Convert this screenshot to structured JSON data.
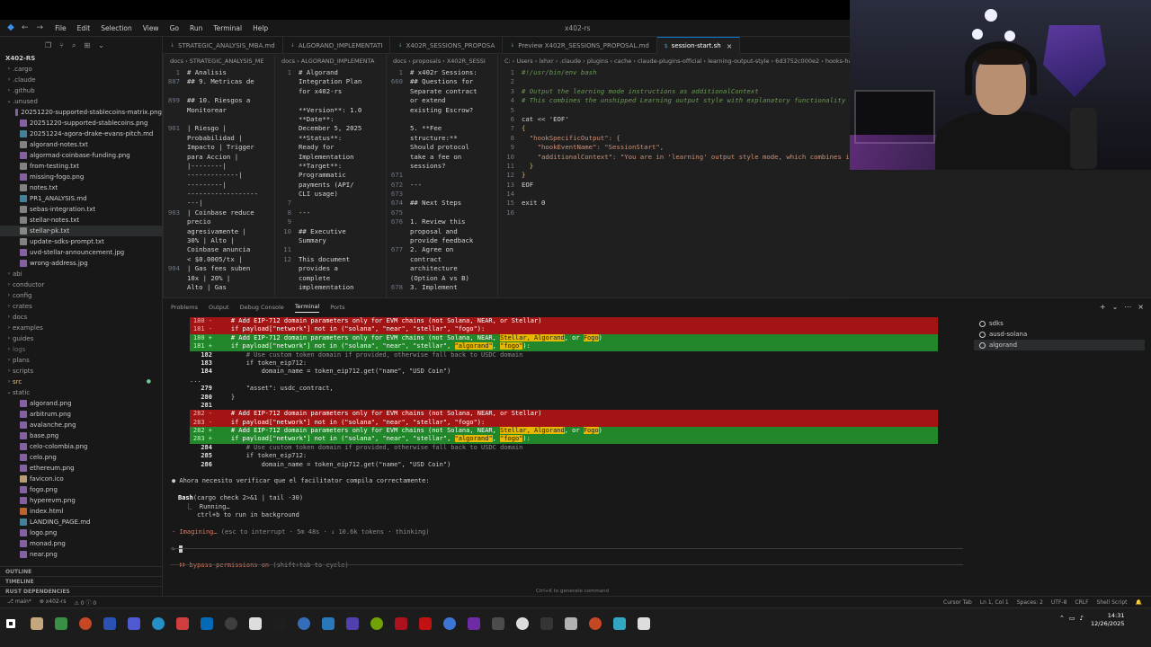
{
  "window": {
    "title": "x402-rs",
    "menu": [
      "File",
      "Edit",
      "Selection",
      "View",
      "Go",
      "Run",
      "Terminal",
      "Help"
    ]
  },
  "explorer": {
    "root": "X402-RS",
    "items": [
      {
        "label": ".cargo",
        "kind": "folder",
        "indent": 0,
        "color": "#9d9d9d"
      },
      {
        "label": ".claude",
        "kind": "folder",
        "indent": 0,
        "color": "#9d9d9d"
      },
      {
        "label": ".github",
        "kind": "folder",
        "indent": 0,
        "color": "#9d9d9d"
      },
      {
        "label": ".unused",
        "kind": "folder-open",
        "indent": 0,
        "color": "#9d9d9d"
      },
      {
        "label": "20251220-supported-stablecoins-matrix.png",
        "kind": "file",
        "indent": 1,
        "color": "#a074c4"
      },
      {
        "label": "20251220-supported-stablecoins.png",
        "kind": "file",
        "indent": 1,
        "color": "#a074c4"
      },
      {
        "label": "20251224-agora-drake-evans-pitch.md",
        "kind": "file",
        "indent": 1,
        "color": "#519aba"
      },
      {
        "label": "algorand-notes.txt",
        "kind": "file",
        "indent": 1,
        "color": "#9d9d9d"
      },
      {
        "label": "algormad-coinbase-funding.png",
        "kind": "file",
        "indent": 1,
        "color": "#a074c4"
      },
      {
        "label": "from-testing.txt",
        "kind": "file",
        "indent": 1,
        "color": "#9d9d9d"
      },
      {
        "label": "missing-fogo.png",
        "kind": "file",
        "indent": 1,
        "color": "#a074c4"
      },
      {
        "label": "notes.txt",
        "kind": "file",
        "indent": 1,
        "color": "#9d9d9d"
      },
      {
        "label": "PR1_ANALYSIS.md",
        "kind": "file",
        "indent": 1,
        "color": "#519aba"
      },
      {
        "label": "sebas-integration.txt",
        "kind": "file",
        "indent": 1,
        "color": "#9d9d9d"
      },
      {
        "label": "stellar-notes.txt",
        "kind": "file",
        "indent": 1,
        "color": "#9d9d9d"
      },
      {
        "label": "stellar-pk.txt",
        "kind": "file",
        "indent": 1,
        "color": "#9d9d9d",
        "selected": true
      },
      {
        "label": "update-sdks-prompt.txt",
        "kind": "file",
        "indent": 1,
        "color": "#9d9d9d"
      },
      {
        "label": "uvd-stellar-announcement.jpg",
        "kind": "file",
        "indent": 1,
        "color": "#a074c4"
      },
      {
        "label": "wrong-address.jpg",
        "kind": "file",
        "indent": 1,
        "color": "#a074c4"
      },
      {
        "label": "abi",
        "kind": "folder",
        "indent": 0,
        "color": "#9d9d9d"
      },
      {
        "label": "conductor",
        "kind": "folder",
        "indent": 0,
        "color": "#9d9d9d"
      },
      {
        "label": "config",
        "kind": "folder",
        "indent": 0,
        "color": "#9d9d9d"
      },
      {
        "label": "crates",
        "kind": "folder",
        "indent": 0,
        "color": "#9d9d9d"
      },
      {
        "label": "docs",
        "kind": "folder",
        "indent": 0,
        "color": "#9d9d9d"
      },
      {
        "label": "examples",
        "kind": "folder",
        "indent": 0,
        "color": "#9d9d9d"
      },
      {
        "label": "guides",
        "kind": "folder",
        "indent": 0,
        "color": "#9d9d9d"
      },
      {
        "label": "logs",
        "kind": "folder",
        "indent": 0,
        "color": "#6e6e6e"
      },
      {
        "label": "plans",
        "kind": "folder",
        "indent": 0,
        "color": "#9d9d9d"
      },
      {
        "label": "scripts",
        "kind": "folder",
        "indent": 0,
        "color": "#9d9d9d"
      },
      {
        "label": "src",
        "kind": "folder",
        "indent": 0,
        "color": "#e2c08d",
        "dot": true
      },
      {
        "label": "static",
        "kind": "folder-open",
        "indent": 0,
        "color": "#9d9d9d"
      },
      {
        "label": "algorand.png",
        "kind": "file",
        "indent": 1,
        "color": "#a074c4"
      },
      {
        "label": "arbitrum.png",
        "kind": "file",
        "indent": 1,
        "color": "#a074c4"
      },
      {
        "label": "avalanche.png",
        "kind": "file",
        "indent": 1,
        "color": "#a074c4"
      },
      {
        "label": "base.png",
        "kind": "file",
        "indent": 1,
        "color": "#a074c4"
      },
      {
        "label": "celo-colombia.png",
        "kind": "file",
        "indent": 1,
        "color": "#a074c4"
      },
      {
        "label": "celo.png",
        "kind": "file",
        "indent": 1,
        "color": "#a074c4"
      },
      {
        "label": "ethereum.png",
        "kind": "file",
        "indent": 1,
        "color": "#a074c4"
      },
      {
        "label": "favicon.ico",
        "kind": "file",
        "indent": 1,
        "color": "#e2c08d"
      },
      {
        "label": "fogo.png",
        "kind": "file",
        "indent": 1,
        "color": "#a074c4"
      },
      {
        "label": "hyperevm.png",
        "kind": "file",
        "indent": 1,
        "color": "#a074c4"
      },
      {
        "label": "index.html",
        "kind": "file",
        "indent": 1,
        "color": "#e37933"
      },
      {
        "label": "LANDING_PAGE.md",
        "kind": "file",
        "indent": 1,
        "color": "#519aba"
      },
      {
        "label": "logo.png",
        "kind": "file",
        "indent": 1,
        "color": "#a074c4"
      },
      {
        "label": "monad.png",
        "kind": "file",
        "indent": 1,
        "color": "#a074c4"
      },
      {
        "label": "near.png",
        "kind": "file",
        "indent": 1,
        "color": "#a074c4"
      }
    ],
    "outline": "OUTLINE",
    "timeline": "TIMELINE",
    "rust_deps": "RUST DEPENDENCIES"
  },
  "tabs": [
    {
      "label": "STRATEGIC_ANALYSIS_MBA.md",
      "active": false
    },
    {
      "label": "ALGORAND_IMPLEMENTATI",
      "active": false
    },
    {
      "label": "X402R_SESSIONS_PROPOSA",
      "active": false
    },
    {
      "label": "Preview X402R_SESSIONS_PROPOSAL.md",
      "active": false
    },
    {
      "label": "session-start.sh",
      "active": true
    }
  ],
  "panes": [
    {
      "crumb": "docs › STRATEGIC_ANALYSIS_ME",
      "lines": [
        {
          "n": "1",
          "t": "# Analisis"
        },
        {
          "n": "887",
          "t": "## 9. Metricas de"
        },
        {
          "n": "",
          "t": ""
        },
        {
          "n": "899",
          "t": "## 10. Riesgos a"
        },
        {
          "n": "",
          "t": "Monitorear"
        },
        {
          "n": "",
          "t": ""
        },
        {
          "n": "901",
          "t": "| Riesgo |"
        },
        {
          "n": "",
          "t": "Probabilidad |"
        },
        {
          "n": "",
          "t": "Impacto | Trigger"
        },
        {
          "n": "",
          "t": "para Accion |"
        },
        {
          "n": "",
          "t": "|--------|"
        },
        {
          "n": "",
          "t": "-------------|"
        },
        {
          "n": "",
          "t": "---------|"
        },
        {
          "n": "",
          "t": "------------------"
        },
        {
          "n": "",
          "t": "---|"
        },
        {
          "n": "903",
          "t": "| Coinbase reduce"
        },
        {
          "n": "",
          "t": "precio"
        },
        {
          "n": "",
          "t": "agresivamente |"
        },
        {
          "n": "",
          "t": "30% | Alto |"
        },
        {
          "n": "",
          "t": "Coinbase anuncia"
        },
        {
          "n": "",
          "t": "< $0.0005/tx |"
        },
        {
          "n": "904",
          "t": "| Gas fees suben"
        },
        {
          "n": "",
          "t": "10x | 20% |"
        },
        {
          "n": "",
          "t": "Alto | Gas"
        }
      ]
    },
    {
      "crumb": "docs › ALGORAND_IMPLEMENTA",
      "lines": [
        {
          "n": "1",
          "t": "# Algorand"
        },
        {
          "n": "",
          "t": "Integration Plan"
        },
        {
          "n": "",
          "t": "for x402-rs"
        },
        {
          "n": "",
          "t": ""
        },
        {
          "n": "",
          "t": "**Version**: 1.0"
        },
        {
          "n": "",
          "t": "**Date**:"
        },
        {
          "n": "",
          "t": "December 5, 2025"
        },
        {
          "n": "",
          "t": "**Status**:"
        },
        {
          "n": "",
          "t": "Ready for"
        },
        {
          "n": "",
          "t": "Implementation"
        },
        {
          "n": "",
          "t": "**Target**:"
        },
        {
          "n": "",
          "t": "Programmatic"
        },
        {
          "n": "",
          "t": "payments (API/"
        },
        {
          "n": "",
          "t": "CLI usage)"
        },
        {
          "n": "7",
          "t": ""
        },
        {
          "n": "8",
          "t": "---"
        },
        {
          "n": "9",
          "t": ""
        },
        {
          "n": "10",
          "t": "## Executive"
        },
        {
          "n": "",
          "t": "Summary"
        },
        {
          "n": "11",
          "t": ""
        },
        {
          "n": "12",
          "t": "This document"
        },
        {
          "n": "",
          "t": "provides a"
        },
        {
          "n": "",
          "t": "complete"
        },
        {
          "n": "",
          "t": "implementation"
        }
      ]
    },
    {
      "crumb": "docs › proposals › X402R_SESSI",
      "lines": [
        {
          "n": "1",
          "t": "# x402r Sessions:"
        },
        {
          "n": "660",
          "t": "## Questions for"
        },
        {
          "n": "",
          "t": "Separate contract"
        },
        {
          "n": "",
          "t": "or extend"
        },
        {
          "n": "",
          "t": "existing Escrow?"
        },
        {
          "n": "",
          "t": ""
        },
        {
          "n": "",
          "t": "5. **Fee"
        },
        {
          "n": "",
          "t": "structure:**"
        },
        {
          "n": "",
          "t": "Should protocol"
        },
        {
          "n": "",
          "t": "take a fee on"
        },
        {
          "n": "",
          "t": "sessions?"
        },
        {
          "n": "671",
          "t": ""
        },
        {
          "n": "672",
          "t": "---"
        },
        {
          "n": "673",
          "t": ""
        },
        {
          "n": "674",
          "t": "## Next Steps"
        },
        {
          "n": "675",
          "t": ""
        },
        {
          "n": "676",
          "t": "1. Review this"
        },
        {
          "n": "",
          "t": "proposal and"
        },
        {
          "n": "",
          "t": "provide feedback"
        },
        {
          "n": "677",
          "t": "2. Agree on"
        },
        {
          "n": "",
          "t": "contract"
        },
        {
          "n": "",
          "t": "architecture"
        },
        {
          "n": "",
          "t": "(Option A vs B)"
        },
        {
          "n": "678",
          "t": "3. Implement"
        }
      ]
    },
    {
      "crumb": "C: › Users › lxhxr › .claude › plugins › cache › claude-plugins-official › learning-output-style › 6d3752c000e2 › hooks-handlers › session-start.sh",
      "lines": [
        {
          "n": "1",
          "t": "#!/usr/bin/env bash",
          "cls": "c-green"
        },
        {
          "n": "2",
          "t": ""
        },
        {
          "n": "3",
          "t": "# Output the learning mode instructions as additionalContext",
          "cls": "c-green"
        },
        {
          "n": "4",
          "t": "# This combines the unshipped Learning output style with explanatory functionality",
          "cls": "c-green"
        },
        {
          "n": "5",
          "t": ""
        },
        {
          "n": "6",
          "t": "cat << 'EOF'",
          "cls": ""
        },
        {
          "n": "7",
          "t": "{",
          "cls": "c-yellow"
        },
        {
          "n": "8",
          "t": "  \"hookSpecificOutput\": {",
          "cls": "c-str"
        },
        {
          "n": "9",
          "t": "    \"hookEventName\": \"SessionStart\",",
          "cls": "c-str"
        },
        {
          "n": "10",
          "t": "    \"additionalContext\": \"You are in 'learning' output style mode, which combines interactive lear",
          "cls": "c-str"
        },
        {
          "n": "11",
          "t": "  }",
          "cls": "c-yellow"
        },
        {
          "n": "12",
          "t": "}",
          "cls": "c-yellow"
        },
        {
          "n": "13",
          "t": "EOF",
          "cls": ""
        },
        {
          "n": "14",
          "t": ""
        },
        {
          "n": "15",
          "t": "exit 0",
          "cls": ""
        },
        {
          "n": "16",
          "t": ""
        }
      ]
    }
  ],
  "panel": {
    "tabs": [
      "Problems",
      "Output",
      "Debug Console",
      "Terminal",
      "Ports"
    ],
    "active_tab": "Terminal",
    "terminals": [
      "sdks",
      "ausd-solana",
      "algorand"
    ],
    "selected_terminal": "algorand",
    "diff1": [
      {
        "type": "del",
        "num": "180 -",
        "text": "    # Add EIP-712 domain parameters only for EVM chains (not Solana, NEAR, or Stellar)"
      },
      {
        "type": "del",
        "num": "181 -",
        "text": "    if payload[\"network\"] not in (\"solana\", \"near\", \"stellar\", \"fogo\"):"
      },
      {
        "type": "add",
        "num": "180 +",
        "pre": "    # Add EIP-712 domain parameters only for EVM chains (not Solana, NEAR, ",
        "hl1": "Stellar, Algorand",
        "mid": ", or ",
        "hl2": "Fogo",
        "post": ")"
      },
      {
        "type": "add",
        "num": "181 +",
        "pre": "    if payload[\"network\"] not in (\"solana\", \"near\", \"stellar\", ",
        "hl1": "\"algorand\"",
        "mid": ", ",
        "hl2": "\"fogo\"",
        "post": "):"
      },
      {
        "type": "ctx",
        "num": "182",
        "text": "        # Use custom token domain if provided, otherwise fall back to USDC domain",
        "dim": true
      },
      {
        "type": "ctx",
        "num": "183",
        "text": "        if token_eip712:"
      },
      {
        "type": "ctx",
        "num": "184",
        "text": "            domain_name = token_eip712.get(\"name\", \"USD Coin\")"
      }
    ],
    "ellipsis": "...",
    "diff_mid": [
      {
        "type": "ctx",
        "num": "279",
        "text": "        \"asset\": usdc_contract,"
      },
      {
        "type": "ctx",
        "num": "280",
        "text": "    }"
      },
      {
        "type": "ctx",
        "num": "281",
        "text": ""
      }
    ],
    "diff2": [
      {
        "type": "del",
        "num": "282 -",
        "text": "    # Add EIP-712 domain parameters only for EVM chains (not Solana, NEAR, or Stellar)"
      },
      {
        "type": "del",
        "num": "283 -",
        "text": "    if payload[\"network\"] not in (\"solana\", \"near\", \"stellar\", \"fogo\"):"
      },
      {
        "type": "add",
        "num": "282 +",
        "pre": "    # Add EIP-712 domain parameters only for EVM chains (not Solana, NEAR, ",
        "hl1": "Stellar, Algorand",
        "mid": ", or ",
        "hl2": "Fogo",
        "post": ")"
      },
      {
        "type": "add",
        "num": "283 +",
        "pre": "    if payload[\"network\"] not in (\"solana\", \"near\", \"stellar\", ",
        "hl1": "\"algorand\"",
        "mid": ", ",
        "hl2": "\"fogo\"",
        "post": "):"
      },
      {
        "type": "ctx",
        "num": "284",
        "text": "        # Use custom token domain if provided, otherwise fall back to USDC domain",
        "dim": true
      },
      {
        "type": "ctx",
        "num": "285",
        "text": "        if token_eip712:"
      },
      {
        "type": "ctx",
        "num": "286",
        "text": "            domain_name = token_eip712.get(\"name\", \"USD Coin\")"
      }
    ],
    "message": "● Ahora necesito verificar que el facilitator compila correctamente:",
    "bash_label": "Bash",
    "bash_cmd": "(cargo check 2>&1 | tail -30)",
    "running": "  ⎿  Running…",
    "bg_hint": "     ctrl+b to run in background",
    "imagining_prefix": "· ",
    "imagining": "Imagining…",
    "imagining_status": " (esc to interrupt · 5m 48s · ↓ 10.6k tokens · thinking)",
    "prompt": ">",
    "bypass": "  ⏵⏵ bypass permissions on",
    "bypass_hint": " (shift+tab to cycle)",
    "ctrl_k_hint": "Ctrl+K to generate command"
  },
  "statusbar": {
    "left": [
      "⎇ main*",
      "⊗ x402-rs",
      "⚠ 0 ⓘ 0"
    ],
    "right": [
      "Cursor Tab",
      "Ln 1, Col 1",
      "Spaces: 2",
      "UTF-8",
      "CRLF",
      "Shell Script",
      "🔔"
    ]
  },
  "taskbar": {
    "time": "14:31",
    "date": "12/26/2025",
    "icons": [
      "#ffffff",
      "#e2c08d",
      "#3fa34d",
      "#e34f26",
      "#2b5cce",
      "#5865f2",
      "#26a5e4",
      "#e44",
      "#0078d4",
      "#444",
      "#ffffff",
      "#1e1e1e",
      "#3b7bd4",
      "#2b88d8",
      "#5a48c8",
      "#7fba00",
      "#c50f1f",
      "#d11",
      "#4285f4",
      "#7b2fbe",
      "#555",
      "#ffffff",
      "#3a3a3a",
      "#cccccc",
      "#e34f26",
      "#35c0e0",
      "#ffffff"
    ]
  }
}
